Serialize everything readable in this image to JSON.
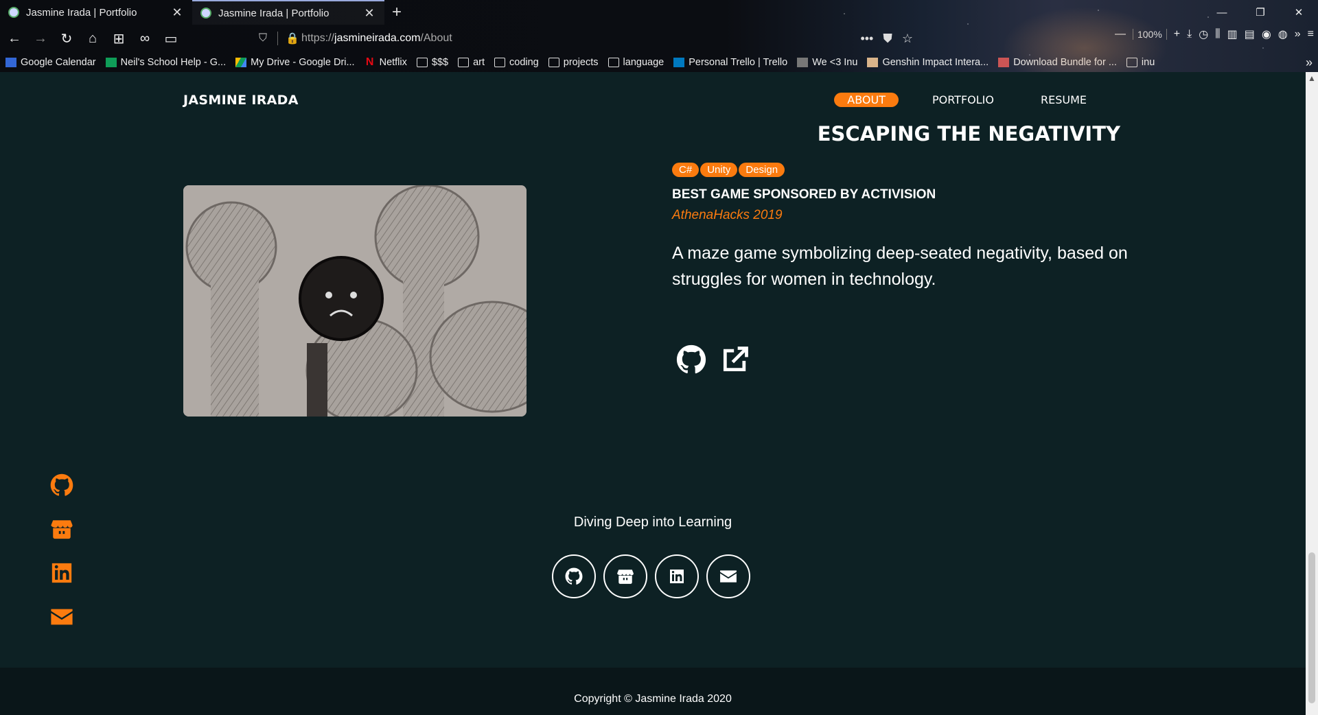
{
  "browser": {
    "tabs": [
      {
        "title": "Jasmine Irada | Portfolio",
        "active": false
      },
      {
        "title": "Jasmine Irada | Portfolio",
        "active": true
      }
    ],
    "url": {
      "scheme": "https://",
      "domain": "jasmineirada.com",
      "path": "/About"
    },
    "zoom": "100%",
    "bookmarks": [
      {
        "label": "Google Calendar",
        "icon": "calendar-icon"
      },
      {
        "label": "Neil's School Help - G...",
        "icon": "sheets-icon"
      },
      {
        "label": "My Drive - Google Dri...",
        "icon": "drive-icon"
      },
      {
        "label": "Netflix",
        "icon": "netflix-icon"
      },
      {
        "label": "$$$",
        "icon": "folder-icon"
      },
      {
        "label": "art",
        "icon": "folder-icon"
      },
      {
        "label": "coding",
        "icon": "folder-icon"
      },
      {
        "label": "projects",
        "icon": "folder-icon"
      },
      {
        "label": "language",
        "icon": "folder-icon"
      },
      {
        "label": "Personal Trello | Trello",
        "icon": "trello-icon"
      },
      {
        "label": "We <3 Inu",
        "icon": "cube-icon"
      },
      {
        "label": "Genshin Impact Intera...",
        "icon": "genshin-icon"
      },
      {
        "label": "Download Bundle for ...",
        "icon": "bundle-icon"
      },
      {
        "label": "inu",
        "icon": "folder-icon"
      }
    ]
  },
  "site": {
    "brand": "JASMINE IRADA",
    "nav": [
      {
        "label": "ABOUT",
        "active": true
      },
      {
        "label": "PORTFOLIO",
        "active": false
      },
      {
        "label": "RESUME",
        "active": false
      }
    ],
    "accent": "#fb7b0f",
    "background": "#0d2124"
  },
  "project": {
    "title": "ESCAPING THE NEGATIVITY",
    "tags": [
      "C#",
      "Unity",
      "Design"
    ],
    "award": "BEST GAME SPONSORED BY ACTIVISION",
    "event": "AthenaHacks 2019",
    "description": "A maze game symbolizing deep-seated negativity, based on struggles for women in technology.",
    "links": [
      {
        "icon": "github-icon"
      },
      {
        "icon": "external-link-icon"
      }
    ]
  },
  "sidebar_icons": [
    "github-icon",
    "itchio-icon",
    "linkedin-icon",
    "email-icon"
  ],
  "footer": {
    "tagline": "Diving Deep into Learning",
    "icons": [
      "github-icon",
      "itchio-icon",
      "linkedin-icon",
      "email-icon"
    ],
    "copyright": "Copyright © Jasmine Irada 2020"
  }
}
